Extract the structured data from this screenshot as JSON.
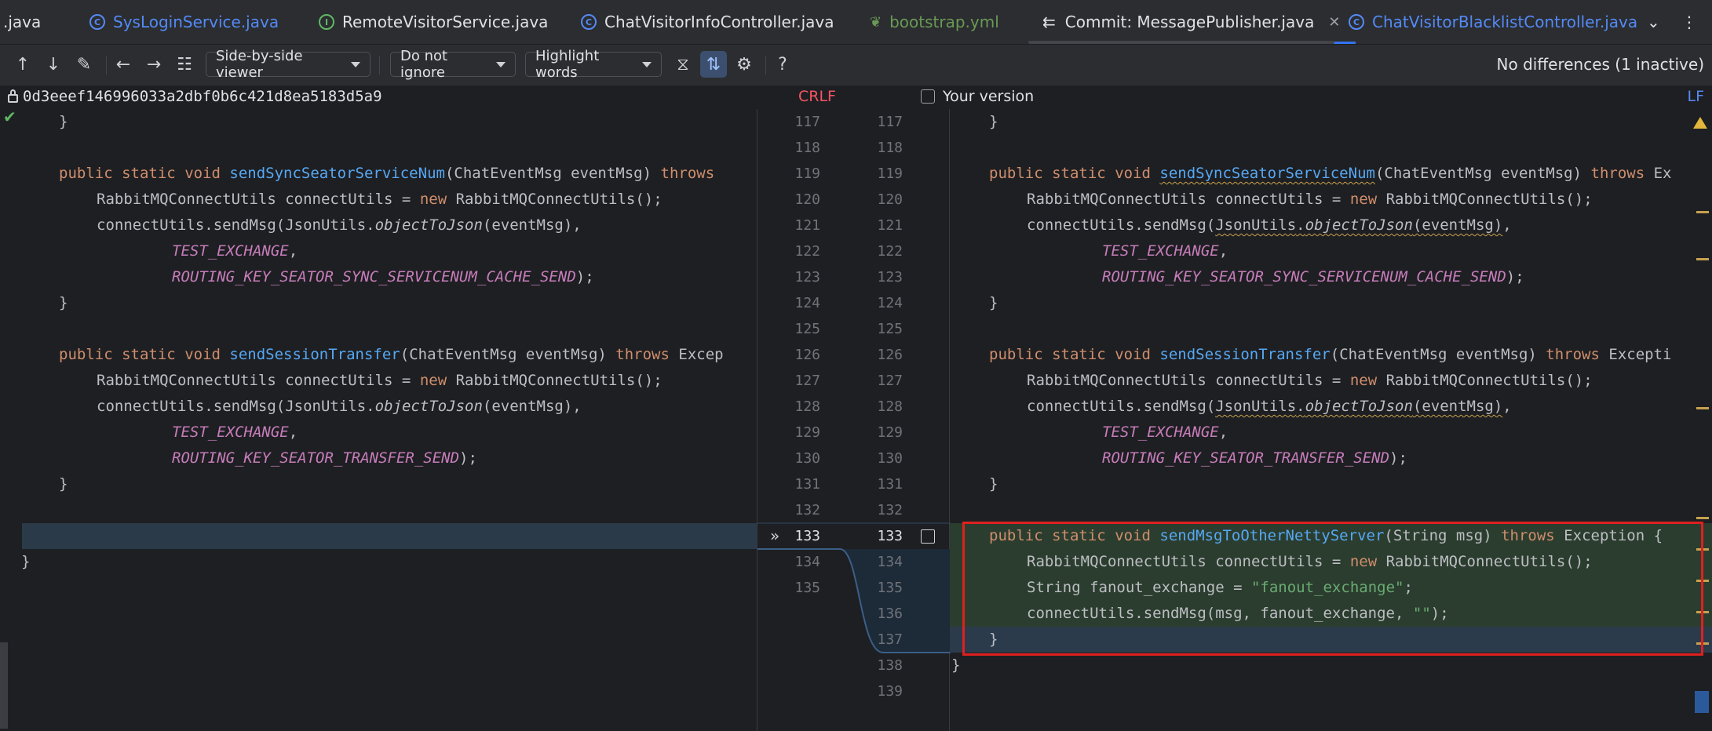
{
  "tabs": [
    {
      "label": ".java",
      "icon": "",
      "style": "plain"
    },
    {
      "label": "SysLoginService.java",
      "icon": "class-icon",
      "style": "link"
    },
    {
      "label": "RemoteVisitorService.java",
      "icon": "interface-icon",
      "style": "plain"
    },
    {
      "label": "ChatVisitorInfoController.java",
      "icon": "class-icon",
      "style": "plain"
    },
    {
      "label": "bootstrap.yml",
      "icon": "yaml-icon",
      "style": "yml"
    },
    {
      "label": "Commit: MessagePublisher.java",
      "icon": "commit-diff-icon",
      "style": "active"
    },
    {
      "label": "ChatVisitorBlacklistController.java",
      "icon": "class-icon",
      "style": "link"
    }
  ],
  "toolbar": {
    "viewer": "Side-by-side viewer",
    "ignore": "Do not ignore",
    "highlight": "Highlight words",
    "status": "No differences (1 inactive)",
    "help": "?"
  },
  "info": {
    "commit_hash": "0d3eeef146996033a2dbf0b6c421d8ea5183d5a9",
    "left_line_sep": "CRLF",
    "right_title": "Your version",
    "right_line_sep": "LF"
  },
  "left_numbers": [
    "117",
    "118",
    "119",
    "120",
    "121",
    "122",
    "123",
    "124",
    "125",
    "126",
    "127",
    "128",
    "129",
    "130",
    "131",
    "132",
    "133",
    "134",
    "135"
  ],
  "right_numbers": [
    "117",
    "118",
    "119",
    "120",
    "121",
    "122",
    "123",
    "124",
    "125",
    "126",
    "127",
    "128",
    "129",
    "130",
    "131",
    "132",
    "133",
    "134",
    "135",
    "136",
    "137",
    "138",
    "139"
  ],
  "code": {
    "brace": "}",
    "public": "public",
    "static": "static",
    "void": "void",
    "throws": "throws",
    "new": "new",
    "m_sync": "sendSyncSeatorServiceNum",
    "m_transfer": "sendSessionTransfer",
    "m_netty": "sendMsgToOtherNettyServer",
    "param": "(ChatEventMsg eventMsg) ",
    "exc_left1": "",
    "exc_left2": "Excep",
    "exc_right1": "Ex",
    "exc_right2": "Excepti",
    "line_conn_a": "RabbitMQConnectUtils connectUtils = ",
    "line_conn_b": "RabbitMQConnectUtils();",
    "send_a": "connectUtils.sendMsg(",
    "json_cls": "JsonUtils",
    "json_dot": ".",
    "json_fn": "objectToJson",
    "json_arg": "(eventMsg)",
    "comma": ",",
    "test_ex": "TEST_EXCHANGE",
    "rk_sync": "ROUTING_KEY_SEATOR_SYNC_SERVICENUM_CACHE_SEND",
    "rk_transfer": "ROUTING_KEY_SEATOR_TRANSFER_SEND",
    "end_call": ");",
    "netty_param": "(String msg) ",
    "netty_exc": "Exception {",
    "fanout_decl": "String fanout_exchange = ",
    "fanout_str": "\"fanout_exchange\"",
    "semi": ";",
    "send_b": "connectUtils.sendMsg(msg, fanout_exchange, ",
    "empty_str": "\"\"",
    "close_call": ");"
  },
  "colors": {
    "accent": "#3574f0",
    "added_bg": "#2b3d2e",
    "highlight_box": "#e02020"
  }
}
